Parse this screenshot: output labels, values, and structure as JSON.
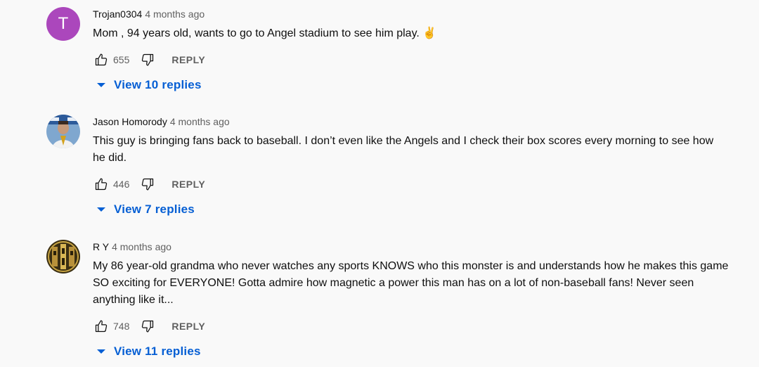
{
  "theme": {
    "link_color": "#065fd4",
    "secondary_text": "#606060",
    "avatar_letter_bg": "#ab47bc"
  },
  "comments": [
    {
      "author": "Trojan0304",
      "time": "4 months ago",
      "avatar_letter": "T",
      "text": "Mom , 94 years old, wants to go to Angel stadium to see him play. ✌",
      "likes": "655",
      "reply_label": "REPLY",
      "view_replies_label": "View 10 replies"
    },
    {
      "author": "Jason Homorody",
      "time": "4 months ago",
      "avatar_icon": "profile-photo-icon",
      "text": "This guy is bringing fans back to baseball. I don’t even like the Angels and I check their box scores every morning to see how he did.",
      "likes": "446",
      "reply_label": "REPLY",
      "view_replies_label": "View 7 replies"
    },
    {
      "author": "R Y",
      "time": "4 months ago",
      "avatar_icon": "ornate-emblem-icon",
      "text": "My 86 year-old grandma who never watches any sports KNOWS who this monster is and understands how he makes this game SO exciting for EVERYONE! Gotta admire how magnetic a power this man has on a lot of non-baseball fans! Never seen anything like it...",
      "likes": "748",
      "reply_label": "REPLY",
      "view_replies_label": "View 11 replies"
    }
  ]
}
